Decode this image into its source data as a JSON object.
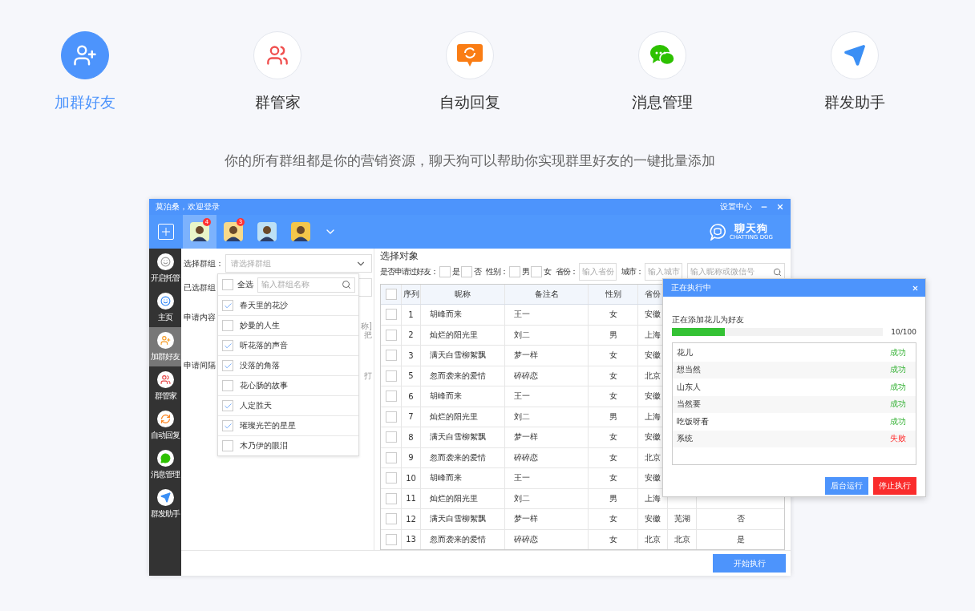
{
  "features": [
    {
      "label": "加群好友",
      "selected": true
    },
    {
      "label": "群管家",
      "selected": false
    },
    {
      "label": "自动回复",
      "selected": false
    },
    {
      "label": "消息管理",
      "selected": false
    },
    {
      "label": "群发助手",
      "selected": false
    }
  ],
  "tagline": "你的所有群组都是你的营销资源，聊天狗可以帮助你实现群里好友的一键批量添加",
  "app": {
    "title": "莫泊桑，欢迎登录",
    "settings": "设置中心",
    "accounts": [
      {
        "badge": "4",
        "selected": true
      },
      {
        "badge": "3",
        "selected": false
      },
      {
        "selected": false
      },
      {
        "selected": false
      }
    ],
    "logo": {
      "name": "聊天狗",
      "tagline": "CHATTING DOG"
    },
    "sidebar": [
      {
        "label": "开启托管",
        "selected": false
      },
      {
        "label": "主页",
        "selected": false
      },
      {
        "label": "加群好友",
        "selected": true
      },
      {
        "label": "群管家",
        "selected": false
      },
      {
        "label": "自动回复",
        "selected": false
      },
      {
        "label": "消息管理",
        "selected": false
      },
      {
        "label": "群发助手",
        "selected": false
      }
    ],
    "form": {
      "group_label": "选择群组：",
      "group_placeholder": "请选择群组",
      "selected_label": "已选群组",
      "content_label": "申请内容",
      "content_fragments": [
        "称]",
        "把"
      ],
      "interval_label": "申请间隔",
      "interval_fragment": "打"
    },
    "dropdown": {
      "select_all": {
        "label": "全选",
        "checked": false
      },
      "search_placeholder": "输入群组名称",
      "items": [
        {
          "label": "春天里的花沙",
          "checked": true
        },
        {
          "label": "妙曼的人生",
          "checked": false
        },
        {
          "label": "听花落的声音",
          "checked": true
        },
        {
          "label": "没落的角落",
          "checked": true
        },
        {
          "label": "花心肠的故事",
          "checked": false
        },
        {
          "label": "人定胜天",
          "checked": true
        },
        {
          "label": "璀璨光芒的星星",
          "checked": true
        },
        {
          "label": "木乃伊的眼泪",
          "checked": false
        }
      ]
    },
    "targets": {
      "title": "选择对象",
      "filters": {
        "applied_label": "是否申请过好友：",
        "applied_options": [
          {
            "label": "是",
            "checked": false
          },
          {
            "label": "否",
            "checked": false
          }
        ],
        "gender_label": "性别：",
        "gender_options": [
          {
            "label": "男",
            "checked": false
          },
          {
            "label": "女",
            "checked": false
          }
        ],
        "province_label": "省份：",
        "province_placeholder": "输入省份",
        "city_label": "城市：",
        "city_placeholder": "输入城市",
        "search_placeholder": "输入昵称或微信号"
      },
      "table": {
        "select_all_checked": false,
        "columns": [
          "序列",
          "昵称",
          "备注名",
          "性别",
          "省份"
        ],
        "rows": [
          {
            "checked": false,
            "no": "1",
            "nickname": "胡峰而来",
            "remark": "王一",
            "gender": "女",
            "province": "安徽"
          },
          {
            "checked": false,
            "no": "2",
            "nickname": "灿烂的阳光里",
            "remark": "刘二",
            "gender": "男",
            "province": "上海"
          },
          {
            "checked": false,
            "no": "3",
            "nickname": "满天白雪柳絮飘",
            "remark": "梦一样",
            "gender": "女",
            "province": "安徽"
          },
          {
            "checked": false,
            "no": "5",
            "nickname": "忽而袭来的爱情",
            "remark": "碎碎恋",
            "gender": "女",
            "province": "北京"
          },
          {
            "checked": false,
            "no": "6",
            "nickname": "胡峰而来",
            "remark": "王一",
            "gender": "女",
            "province": "安徽"
          },
          {
            "checked": false,
            "no": "7",
            "nickname": "灿烂的阳光里",
            "remark": "刘二",
            "gender": "男",
            "province": "上海"
          },
          {
            "checked": false,
            "no": "8",
            "nickname": "满天白雪柳絮飘",
            "remark": "梦一样",
            "gender": "女",
            "province": "安徽"
          },
          {
            "checked": false,
            "no": "9",
            "nickname": "忽而袭来的爱情",
            "remark": "碎碎恋",
            "gender": "女",
            "province": "北京"
          },
          {
            "checked": false,
            "no": "10",
            "nickname": "胡峰而来",
            "remark": "王一",
            "gender": "女",
            "province": "安徽"
          },
          {
            "checked": false,
            "no": "11",
            "nickname": "灿烂的阳光里",
            "remark": "刘二",
            "gender": "男",
            "province": "上海"
          },
          {
            "checked": false,
            "no": "12",
            "nickname": "满天白雪柳絮飘",
            "remark": "梦一样",
            "gender": "女",
            "province": "安徽",
            "city": "芜湖",
            "column_8": "否"
          },
          {
            "checked": false,
            "no": "13",
            "nickname": "忽而袭来的爱情",
            "remark": "碎碎恋",
            "gender": "女",
            "province": "北京",
            "city": "北京",
            "column_8": "是"
          }
        ]
      }
    },
    "start_button": "开始执行",
    "dialog": {
      "title": "正在执行中",
      "status": "正在添加花儿为好友",
      "level": 0.25,
      "count": "10/100",
      "results": [
        {
          "name": "花儿",
          "result": "成功",
          "ok": true
        },
        {
          "name": "想当然",
          "result": "成功",
          "ok": true
        },
        {
          "name": "山东人",
          "result": "成功",
          "ok": true
        },
        {
          "name": "当然要",
          "result": "成功",
          "ok": true
        },
        {
          "name": "吃饭呀看",
          "result": "成功",
          "ok": true
        },
        {
          "name": "系统",
          "result": "失败",
          "ok": false
        }
      ],
      "buttons": [
        {
          "label": "后台运行",
          "kind": "primary"
        },
        {
          "label": "停止执行",
          "kind": "danger"
        }
      ]
    }
  }
}
